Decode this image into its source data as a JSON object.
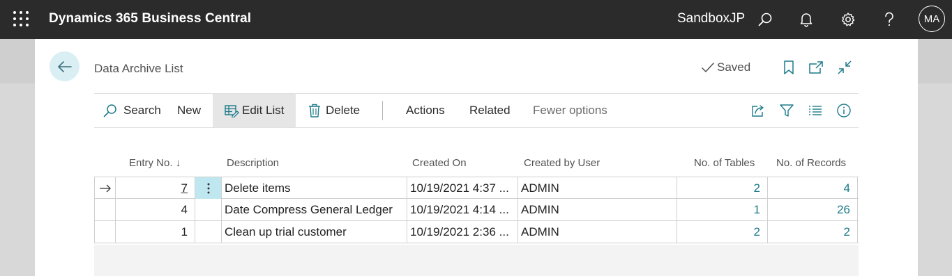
{
  "app": {
    "brand": "Dynamics 365 Business Central",
    "environment": "SandboxJP",
    "user_initials": "MA"
  },
  "page": {
    "title": "Data Archive List",
    "save_status": "Saved"
  },
  "actions": {
    "search": "Search",
    "new": "New",
    "edit_list": "Edit List",
    "delete": "Delete",
    "actions": "Actions",
    "related": "Related",
    "fewer_options": "Fewer options"
  },
  "table": {
    "columns": {
      "entry_no": "Entry No.",
      "sort_indicator": "↓",
      "description": "Description",
      "created_on": "Created On",
      "created_by": "Created by User",
      "no_of_tables": "No. of Tables",
      "no_of_records": "No. of Records"
    },
    "rows": [
      {
        "entry_no": "7",
        "description": "Delete items",
        "created_on": "10/19/2021 4:37 ...",
        "created_by": "ADMIN",
        "no_of_tables": "2",
        "no_of_records": "4"
      },
      {
        "entry_no": "4",
        "description": "Date Compress General Ledger",
        "created_on": "10/19/2021 4:14 ...",
        "created_by": "ADMIN",
        "no_of_tables": "1",
        "no_of_records": "26"
      },
      {
        "entry_no": "1",
        "description": "Clean up trial customer",
        "created_on": "10/19/2021 2:36 ...",
        "created_by": "ADMIN",
        "no_of_tables": "2",
        "no_of_records": "2"
      }
    ]
  },
  "colors": {
    "topbar": "#2b2b2b",
    "accent": "#1c7a8a",
    "selected_cell": "#bfe7ef"
  }
}
